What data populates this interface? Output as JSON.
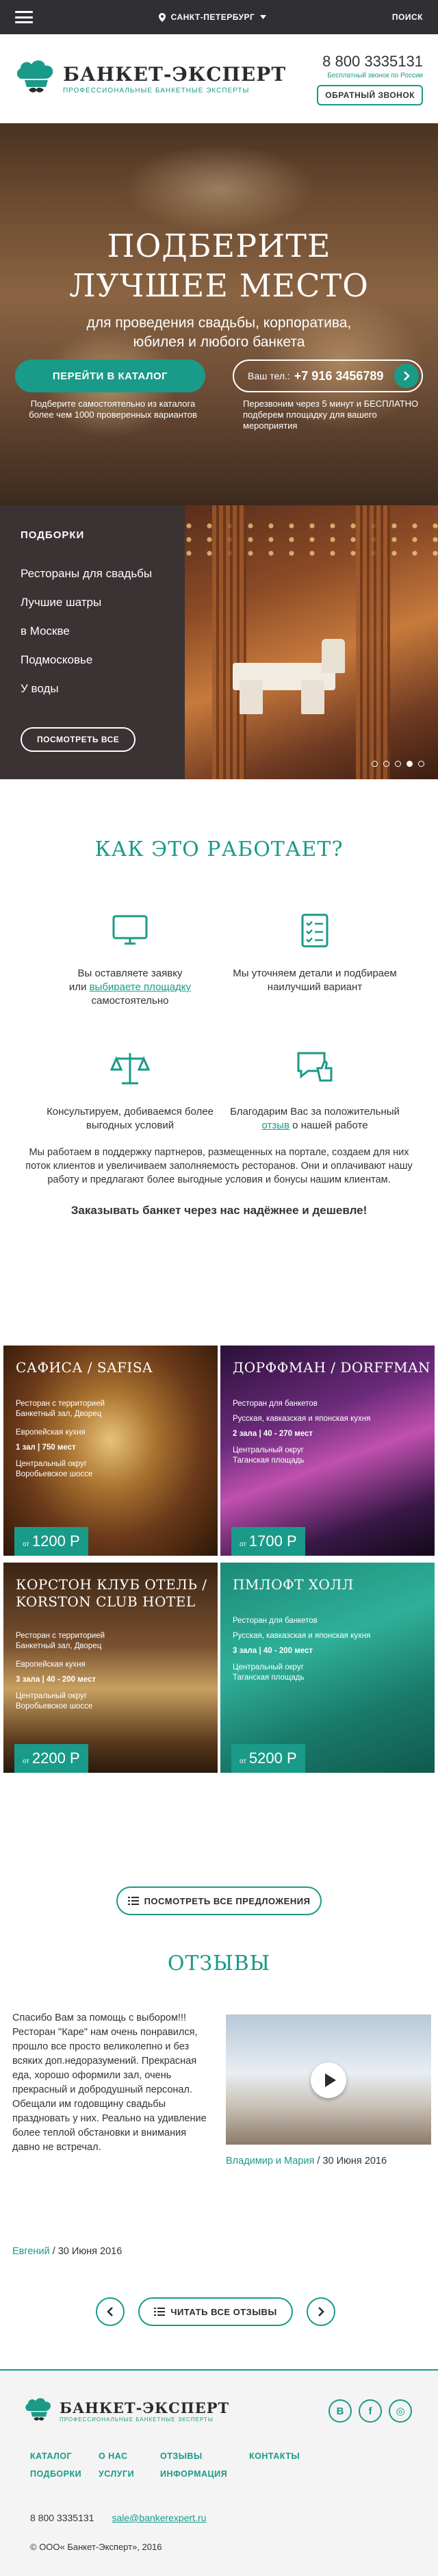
{
  "topbar": {
    "city": "САНКТ-ПЕТЕРБУРГ",
    "search": "ПОИСК"
  },
  "header": {
    "logo_title": "БАНКЕТ-ЭКСПЕРТ",
    "logo_sub": "ПРОФЕССИОНАЛЬНЫЕ БАНКЕТНЫЕ ЭКСПЕРТЫ",
    "phone": "8 800 3335131",
    "phone_note": "Бесплатный звонок по России",
    "callback": "ОБРАТНЫЙ ЗВОНОК"
  },
  "hero": {
    "title_1": "ПОДБЕРИТЕ",
    "title_2": "ЛУЧШЕЕ МЕСТО",
    "sub_1": "для проведения свадьбы, корпоратива,",
    "sub_2": "юбилея и любого банкета",
    "catalog_btn": "ПЕРЕЙТИ В КАТАЛОГ",
    "catalog_note": "Подберите самостоятельно из каталога более чем 1000 проверенных вариантов",
    "phone_label": "Ваш тел.:",
    "phone_value": "+7 916 3456789",
    "phone_note": "Перезвоним через 5 минут и БЕСПЛАТНО подберем площадку для вашего мероприятия"
  },
  "collections": {
    "title": "ПОДБОРКИ",
    "items": [
      "Рестораны для свадьбы",
      "Лучшие шатры",
      "в Москве",
      "Подмосковье",
      "У воды"
    ],
    "button": "ПОСМОТРЕТЬ ВСЕ"
  },
  "how": {
    "title": "КАК ЭТО РАБОТАЕТ?",
    "step1_a": "Вы оставляете заявку",
    "step1_b": "или",
    "step1_link": "выбираете площадку",
    "step1_c": "самостоятельно",
    "step2": "Мы уточняем детали и подбираем наилучший вариант",
    "step3": "Консультируем, добиваемся более выгодных условий",
    "step4_a": "Благодарим Вас за положительный",
    "step4_link": "отзыв",
    "step4_b": "о нашей работе",
    "para": "Мы работаем в поддержку партнеров, размещенных на портале, создаем для них поток клиентов и увеличиваем заполняемость ресторанов. Они и оплачивают нашу работу и предлагают более выгодные условия и бонусы нашим клиентам.",
    "strong": "Заказывать банкет через нас надёжнее и дешевле!"
  },
  "venues": [
    {
      "name": "САФИСА / SAFISA",
      "l1": "Ресторан с территорией",
      "l2": "Банкетный зал, Дворец",
      "cuisine": "Европейская кухня",
      "halls": "1 зал | 750 мест",
      "loc1": "Центральный округ",
      "loc2": "Воробьевское шоссе",
      "price": "1200 Р",
      "from": "от"
    },
    {
      "name": "ДОРФФМАН / DORFFMAN",
      "l1": "Ресторан для банкетов",
      "l2": "",
      "cuisine": "Русская, кавказская и японская кухня",
      "halls": "2 зала | 40 - 270 мест",
      "loc1": "Центральный округ",
      "loc2": "Таганская площадь",
      "price": "1700 Р",
      "from": "от"
    },
    {
      "name": "КОРСТОН КЛУБ ОТЕЛЬ / KORSTON CLUB HOTEL",
      "l1": "Ресторан с территорией",
      "l2": "Банкетный зал, Дворец",
      "cuisine": "Европейская кухня",
      "halls": "3 зала | 40 - 200 мест",
      "loc1": "Центральный округ",
      "loc2": "Воробьевское шоссе",
      "price": "2200 Р",
      "from": "от"
    },
    {
      "name": "ПМЛОФТ ХОЛЛ",
      "l1": "Ресторан для банкетов",
      "l2": "",
      "cuisine": "Русская, кавказская и японская кухня",
      "halls": "3 зала | 40 - 200 мест",
      "loc1": "Центральный округ",
      "loc2": "Таганская площадь",
      "price": "5200 Р",
      "from": "от"
    }
  ],
  "all_offers": "ПОСМОТРЕТЬ ВСЕ ПРЕДЛОЖЕНИЯ",
  "reviews": {
    "title": "ОТЗЫВЫ",
    "text": "Спасибо Вам за помощь с выбором!!! Ресторан \"Каре\" нам очень понравился, прошло все просто великолепно и без всяких доп.недоразумений. Прекрасная еда, хорошо оформили зал, очень прекрасный и добродушный персонал. Обещали им годовщину свадьбы праздновать у них. Реально на удивление более теплой обстановки и внимания давно не встречал.",
    "author": "Евгений",
    "date": "/ 30 Июня 2016",
    "video_author": "Владимир и Мария",
    "video_date": "/ 30 Июня 2016",
    "read_all": "ЧИТАТЬ ВСЕ ОТЗЫВЫ"
  },
  "footer": {
    "logo_title": "БАНКЕТ-ЭКСПЕРТ",
    "logo_sub": "ПРОФЕССИОНАЛЬНЫЕ БАНКЕТНЫЕ ЭКСПЕРТЫ",
    "socials": [
      "В",
      "f",
      "◎"
    ],
    "nav": [
      "КАТАЛОГ",
      "О НАС",
      "ОТЗЫВЫ",
      "КОНТАКТЫ",
      "ПОДБОРКИ",
      "УСЛУГИ",
      "ИНФОРМАЦИЯ"
    ],
    "phone": "8 800 3335131",
    "email": "sale@bankerexpert.ru",
    "copyright": "© ООО« Банкет-Эксперт», 2016"
  },
  "colors": {
    "accent": "#1a9a88",
    "dark": "#2f2f34",
    "panel": "#3a3233"
  }
}
